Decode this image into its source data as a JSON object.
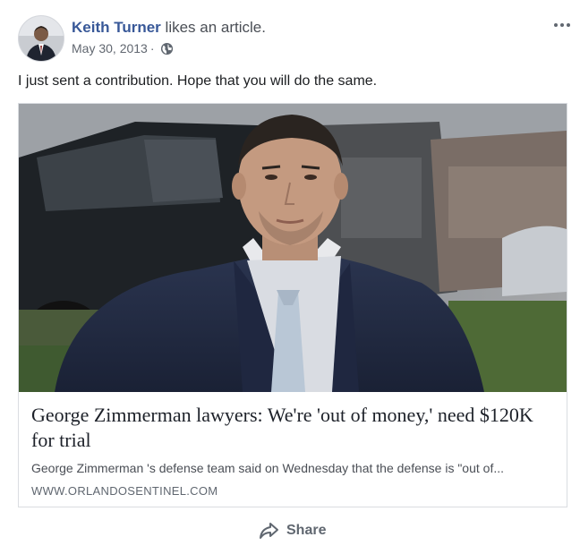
{
  "post": {
    "author_name": "Keith Turner",
    "action": " likes an article.",
    "date": "May 30, 2013",
    "separator": "·",
    "privacy_icon": "globe-icon",
    "more_icon": "more-options-icon",
    "text": "I just sent a contribution. Hope that you will do the same."
  },
  "article": {
    "image_subject": "photo",
    "title": "George Zimmerman lawyers: We're 'out of money,' need $120K for trial",
    "description": "George Zimmerman 's defense team said on Wednesday that the defense is \"out of...",
    "domain": "WWW.ORLANDOSENTINEL.COM"
  },
  "actions": {
    "share_label": "Share",
    "share_icon": "share-icon"
  },
  "colors": {
    "author_link": "#385898",
    "text_primary": "#1c1e21",
    "text_secondary": "#606770",
    "card_border": "#dadde1"
  }
}
